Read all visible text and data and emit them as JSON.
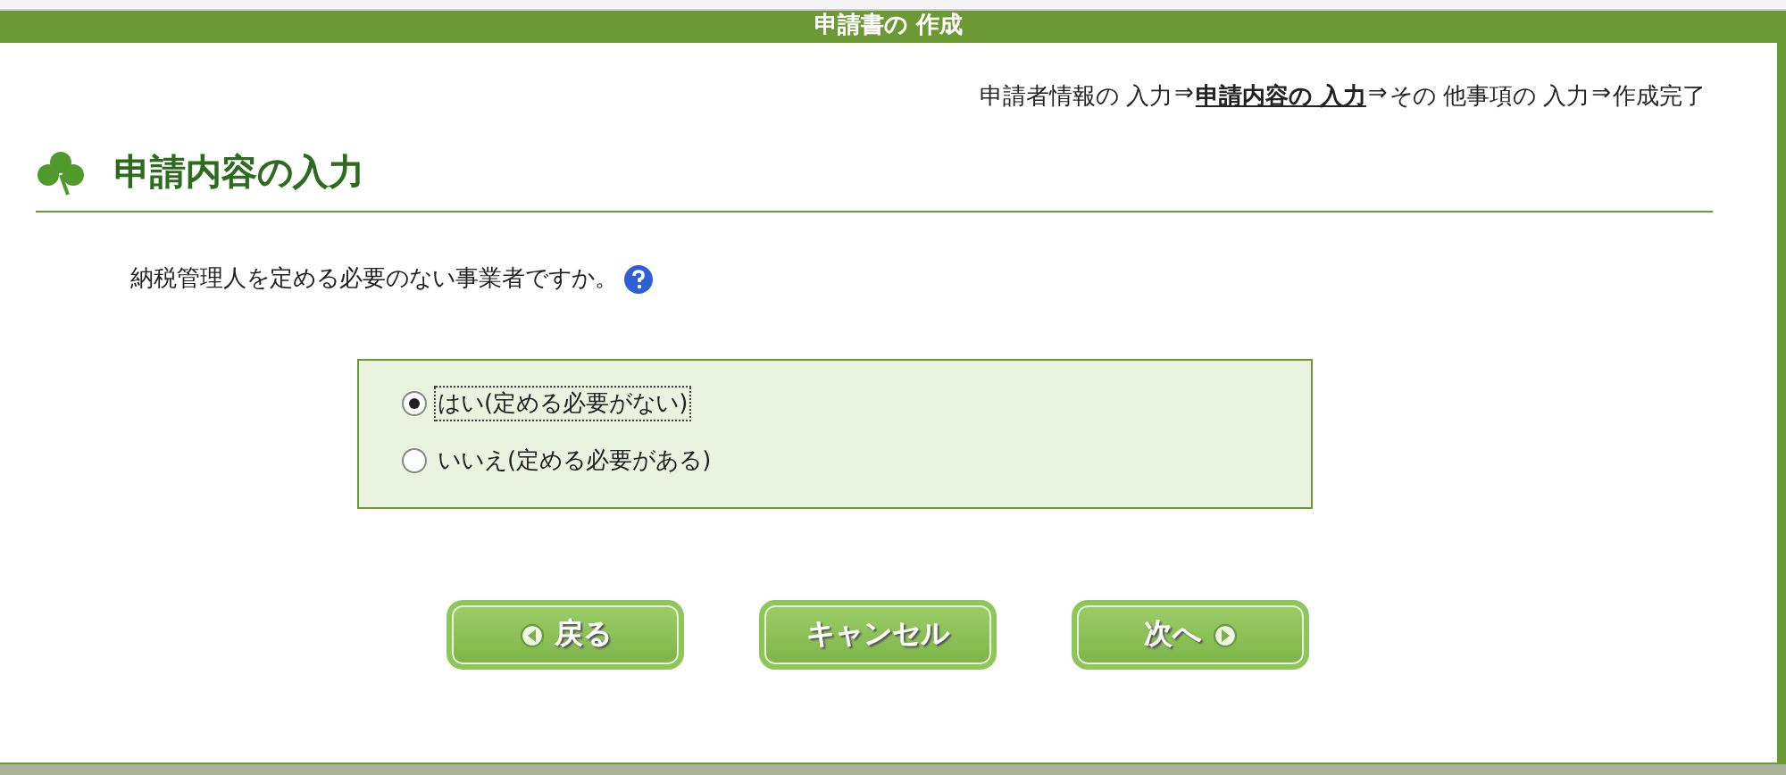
{
  "header": {
    "title": "申請書の 作成"
  },
  "steps": [
    {
      "label": "申請者情報の 入力",
      "selected": false,
      "arrow": "⇒"
    },
    {
      "label": "申請内容の 入力",
      "selected": true,
      "arrow": "⇒"
    },
    {
      "label": "その 他事項の 入力",
      "selected": false,
      "arrow": "⇒"
    },
    {
      "label": "作成完了",
      "selected": false
    }
  ],
  "heading": "申請内容の入力",
  "question": "納税管理人を定める必要のない事業者ですか。",
  "options": [
    {
      "label": "はい(定める必要がない)",
      "selected": true
    },
    {
      "label": "いいえ(定める必要がある)",
      "selected": false
    }
  ],
  "buttons": [
    {
      "label": "戻る",
      "kind": "back"
    },
    {
      "label": "キャンセル",
      "kind": "plain"
    },
    {
      "label": "次へ",
      "kind": "next"
    }
  ]
}
